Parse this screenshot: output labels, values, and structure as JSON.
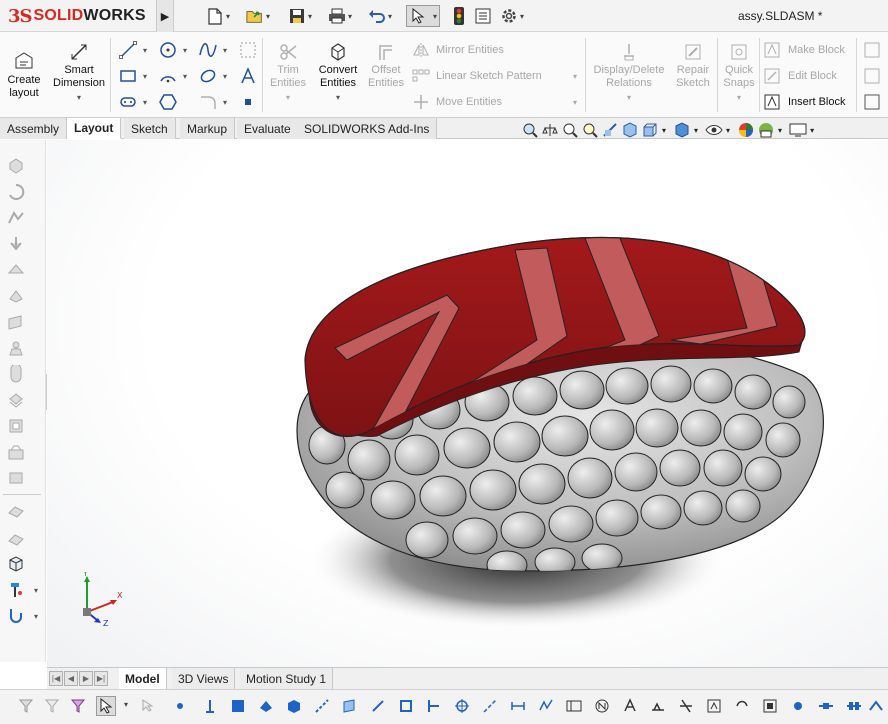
{
  "app": {
    "logo_prefix": "3S",
    "logo_brand_red": "SOLID",
    "logo_brand_dark": "WORKS",
    "document_title": "assy.SLDASM *"
  },
  "colors": {
    "brand_red": "#d9281e",
    "tuna_dark": "#8b1414",
    "tuna_light": "#c25b5b",
    "rice": "#c9c9c9",
    "axis_x": "#d42020",
    "axis_y": "#1e9e2a",
    "axis_z": "#2036c8"
  },
  "quick_access": {
    "icons": [
      "new-document-icon",
      "open-icon",
      "save-icon",
      "print-icon",
      "undo-icon",
      "select-icon",
      "rebuild-icon",
      "file-properties-icon",
      "options-icon"
    ]
  },
  "ribbon": {
    "create_layout": "Create\nlayout",
    "smart_dimension": "Smart\nDimension",
    "trim_entities": "Trim\nEntities",
    "convert_entities": "Convert\nEntities",
    "offset_entities": "Offset\nEntities",
    "mirror_entities": "Mirror Entities",
    "linear_sketch_pattern": "Linear Sketch Pattern",
    "move_entities": "Move Entities",
    "display_delete_relations": "Display/Delete\nRelations",
    "repair_sketch": "Repair\nSketch",
    "quick_snaps": "Quick\nSnaps",
    "make_block": "Make Block",
    "edit_block": "Edit Block",
    "insert_block": "Insert Block"
  },
  "tabs": [
    {
      "label": "Assembly",
      "active": false
    },
    {
      "label": "Layout",
      "active": true
    },
    {
      "label": "Sketch",
      "active": false
    },
    {
      "label": "Markup",
      "active": false
    },
    {
      "label": "Evaluate",
      "active": false
    },
    {
      "label": "SOLIDWORKS Add-Ins",
      "active": false
    }
  ],
  "bottom_tabs": [
    {
      "label": "Model",
      "active": true
    },
    {
      "label": "3D Views",
      "active": false
    },
    {
      "label": "Motion Study 1",
      "active": false
    }
  ],
  "triad": {
    "x": "X",
    "y": "Y",
    "z": "Z"
  }
}
